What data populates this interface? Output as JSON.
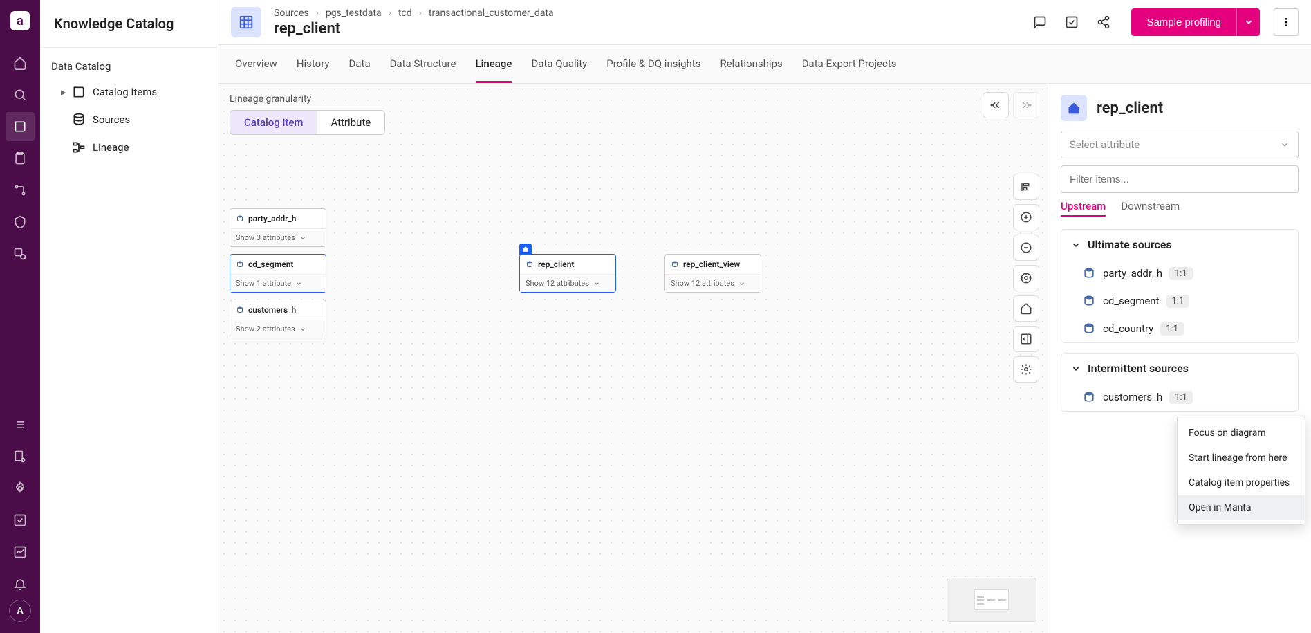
{
  "rail": {
    "avatar": "A"
  },
  "sidebar": {
    "title": "Knowledge Catalog",
    "section": "Data Catalog",
    "items": [
      "Catalog Items",
      "Sources",
      "Lineage"
    ]
  },
  "header": {
    "breadcrumbs": [
      "Sources",
      "pgs_testdata",
      "tcd",
      "transactional_customer_data"
    ],
    "title": "rep_client",
    "primary_button": "Sample profiling"
  },
  "tabs": [
    "Overview",
    "History",
    "Data",
    "Data Structure",
    "Lineage",
    "Data Quality",
    "Profile & DQ insights",
    "Relationships",
    "Data Export Projects"
  ],
  "active_tab": "Lineage",
  "canvas": {
    "label": "Lineage granularity",
    "seg": [
      "Catalog item",
      "Attribute"
    ],
    "seg_active": "Catalog item",
    "nodes": {
      "party_addr_h": {
        "title": "party_addr_h",
        "attr": "Show 3 attributes"
      },
      "cd_segment": {
        "title": "cd_segment",
        "attr": "Show 1 attribute"
      },
      "customers_h": {
        "title": "customers_h",
        "attr": "Show 2 attributes"
      },
      "rep_client": {
        "title": "rep_client",
        "attr": "Show 12 attributes"
      },
      "rep_client_view": {
        "title": "rep_client_view",
        "attr": "Show 12 attributes"
      }
    }
  },
  "rpanel": {
    "title": "rep_client",
    "select_ph": "Select attribute",
    "filter_ph": "Filter items...",
    "ud": [
      "Upstream",
      "Downstream"
    ],
    "ud_active": "Upstream",
    "sections": {
      "ultimate": {
        "title": "Ultimate sources",
        "items": [
          {
            "name": "party_addr_h",
            "badge": "1:1"
          },
          {
            "name": "cd_segment",
            "badge": "1:1"
          },
          {
            "name": "cd_country",
            "badge": "1:1"
          }
        ]
      },
      "intermittent": {
        "title": "Intermittent sources",
        "items": [
          {
            "name": "customers_h",
            "badge": "1:1"
          }
        ]
      }
    }
  },
  "ctx": [
    "Focus on diagram",
    "Start lineage from here",
    "Catalog item properties",
    "Open in Manta"
  ],
  "ctx_hover": "Open in Manta"
}
